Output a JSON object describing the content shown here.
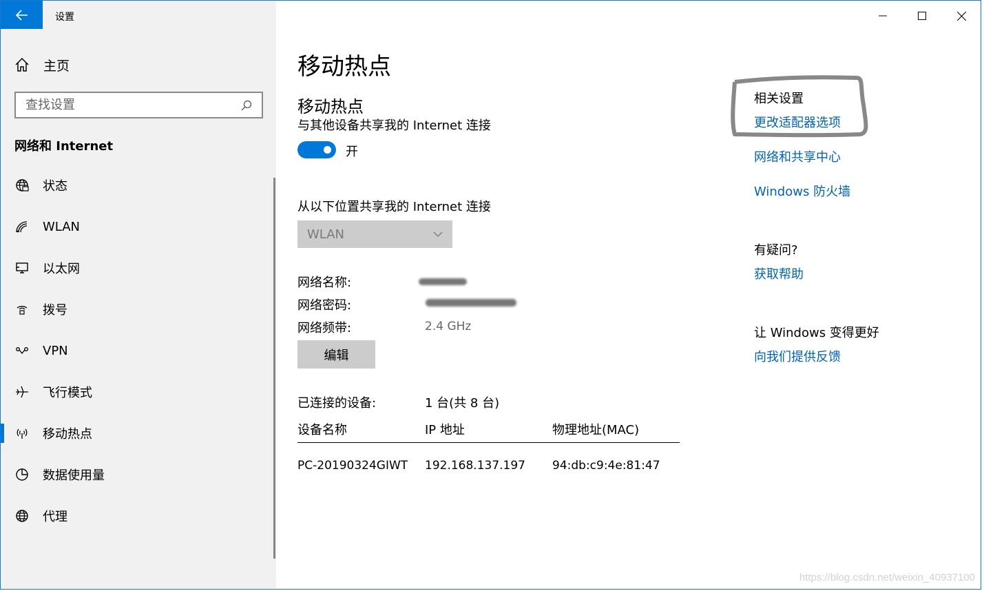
{
  "window": {
    "app_title": "设置"
  },
  "sidebar": {
    "home_label": "主页",
    "search_placeholder": "查找设置",
    "section_title": "网络和 Internet",
    "items": [
      {
        "label": "状态",
        "icon": "globe-status-icon"
      },
      {
        "label": "WLAN",
        "icon": "wifi-icon"
      },
      {
        "label": "以太网",
        "icon": "ethernet-monitor-icon"
      },
      {
        "label": "拨号",
        "icon": "dialup-icon"
      },
      {
        "label": "VPN",
        "icon": "vpn-icon"
      },
      {
        "label": "飞行模式",
        "icon": "airplane-icon"
      },
      {
        "label": "移动热点",
        "icon": "hotspot-icon",
        "active": true
      },
      {
        "label": "数据使用量",
        "icon": "data-usage-icon"
      },
      {
        "label": "代理",
        "icon": "globe-icon"
      }
    ]
  },
  "main": {
    "page_title": "移动热点",
    "sub_title": "移动热点",
    "share_desc": "与其他设备共享我的 Internet 连接",
    "toggle_state": "开",
    "share_from_label": "从以下位置共享我的 Internet 连接",
    "share_from_value": "WLAN",
    "network_name_label": "网络名称:",
    "network_password_label": "网络密码:",
    "network_band_label": "网络频带:",
    "network_band_value": "2.4 GHz",
    "edit_button": "编辑",
    "connected_label": "已连接的设备:",
    "connected_value": "1 台(共 8 台)",
    "table": {
      "headers": [
        "设备名称",
        "IP 地址",
        "物理地址(MAC)"
      ],
      "rows": [
        [
          "PC-20190324GIWT",
          "192.168.137.197",
          "94:db:c9:4e:81:47"
        ]
      ]
    }
  },
  "related": {
    "title": "相关设置",
    "links": [
      "更改适配器选项",
      "网络和共享中心",
      "Windows 防火墙"
    ],
    "question_title": "有疑问?",
    "help_link": "获取帮助",
    "improve_title": "让 Windows 变得更好",
    "feedback_link": "向我们提供反馈"
  },
  "watermark": "https://blog.csdn.net/weixin_40937100",
  "colors": {
    "accent": "#0078d7",
    "link": "#0063b1",
    "sidebar_bg": "#f1f1f1"
  }
}
